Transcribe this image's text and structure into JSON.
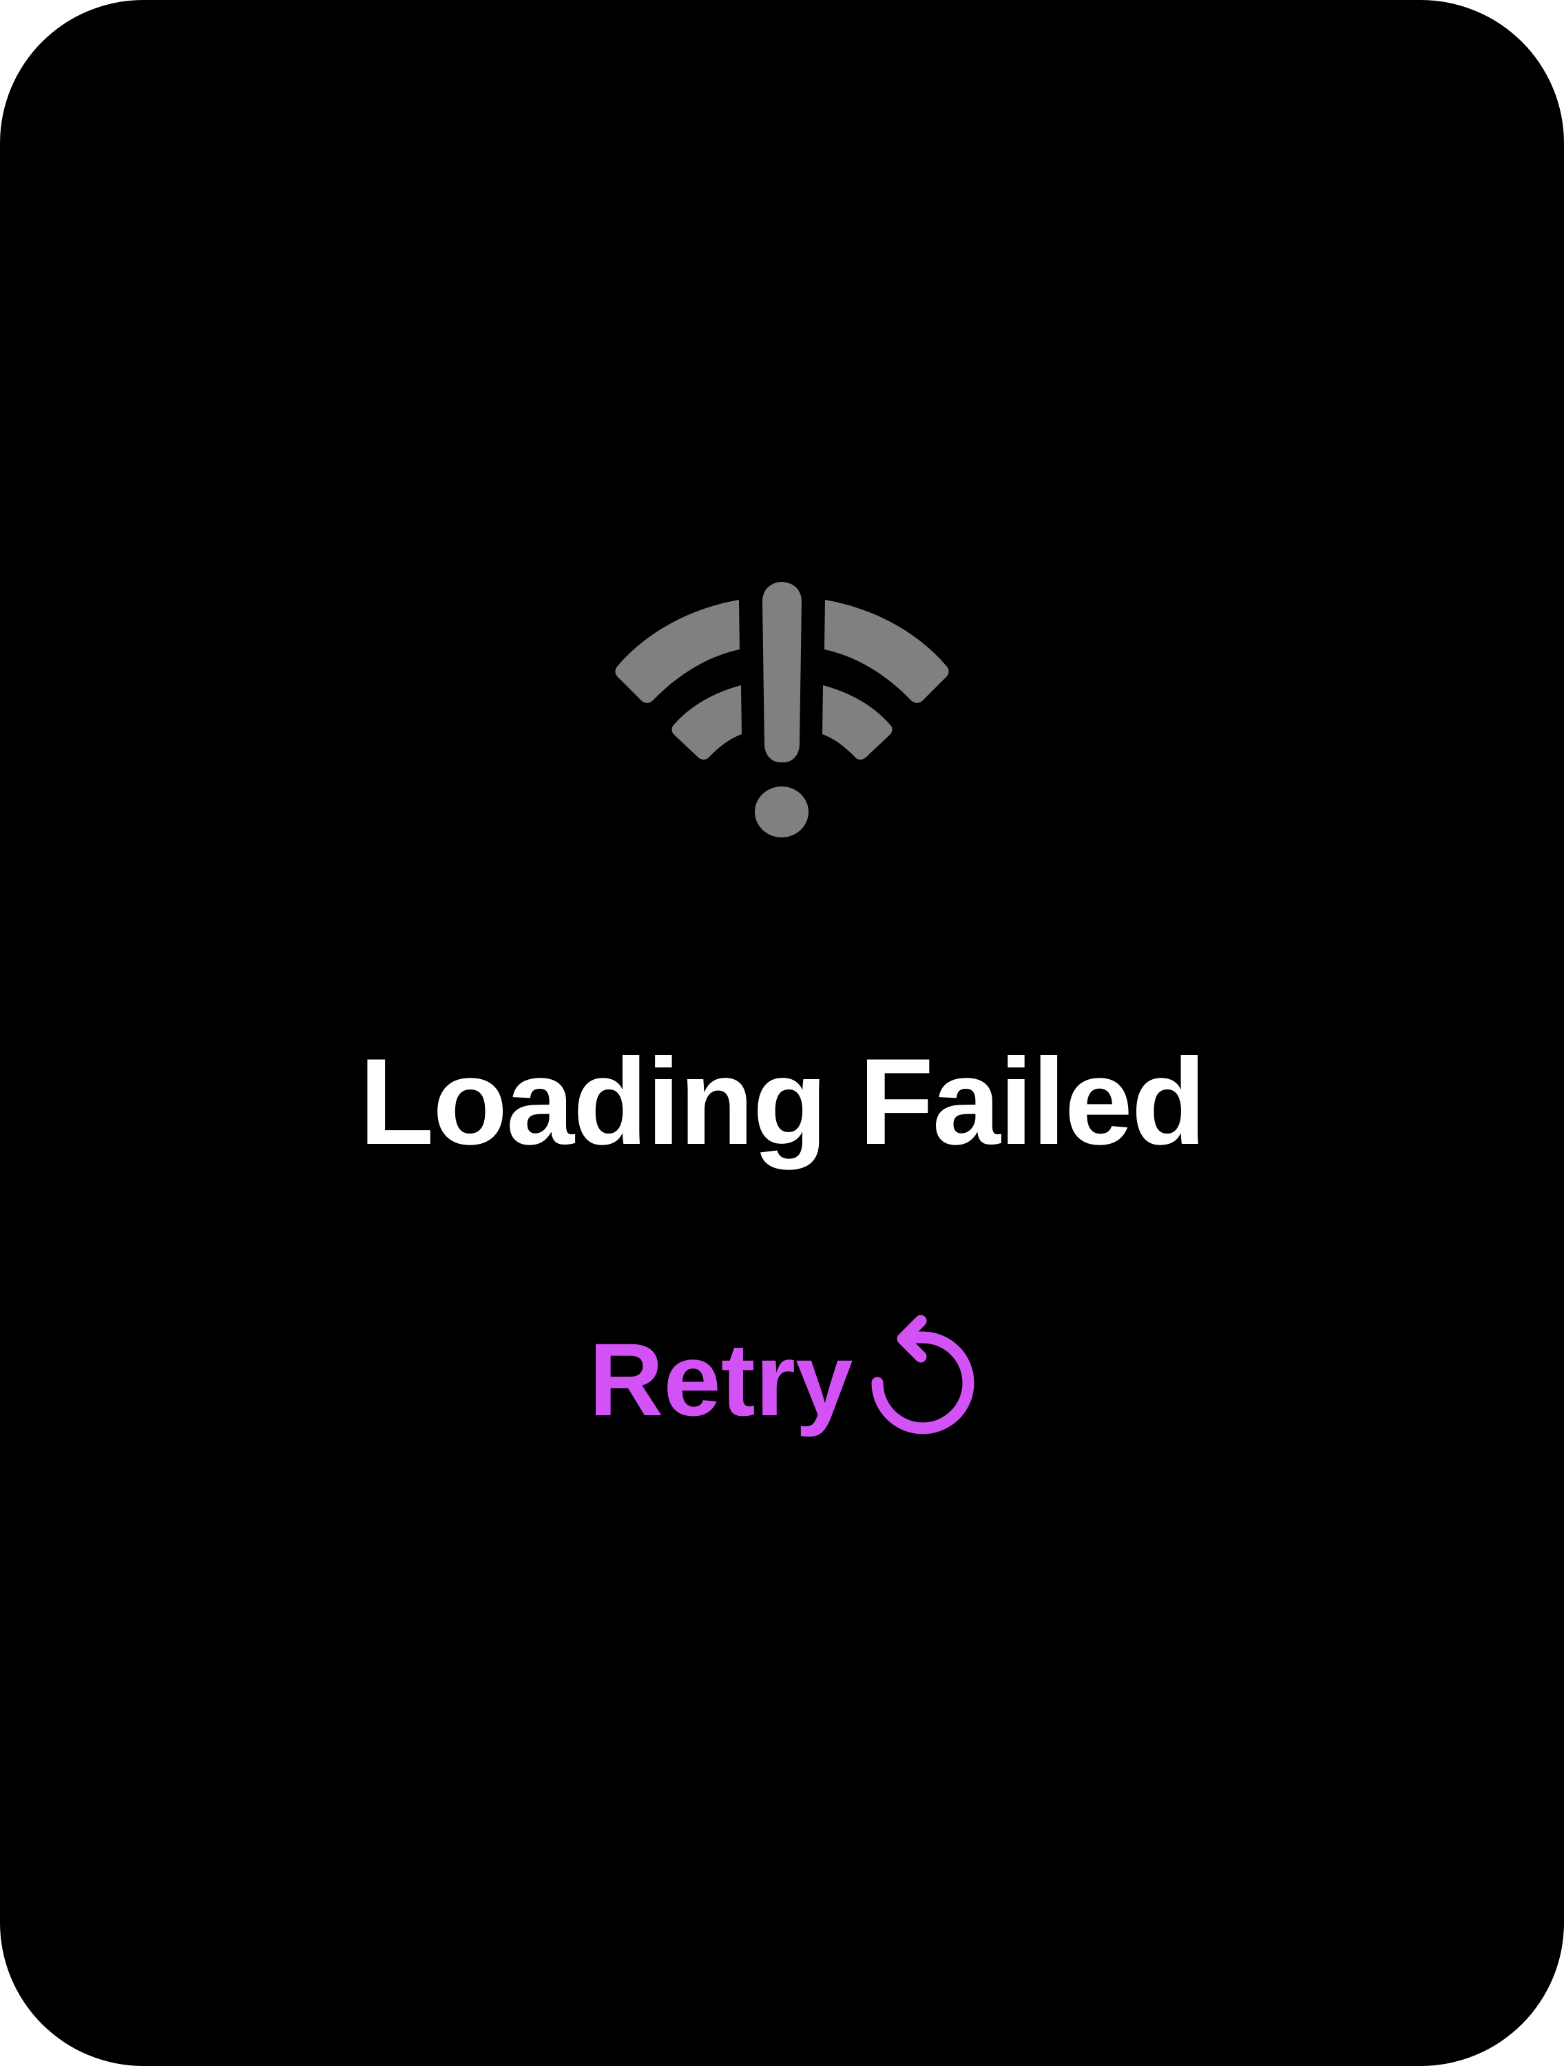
{
  "screen": {
    "background_color": "#000000",
    "icon": "wifi-exclamation-icon",
    "icon_color": "#808080",
    "title": "Loading Failed",
    "title_color": "#ffffff",
    "retry": {
      "label": "Retry",
      "icon": "arrow-counterclockwise-icon",
      "color": "#d352f5"
    }
  }
}
